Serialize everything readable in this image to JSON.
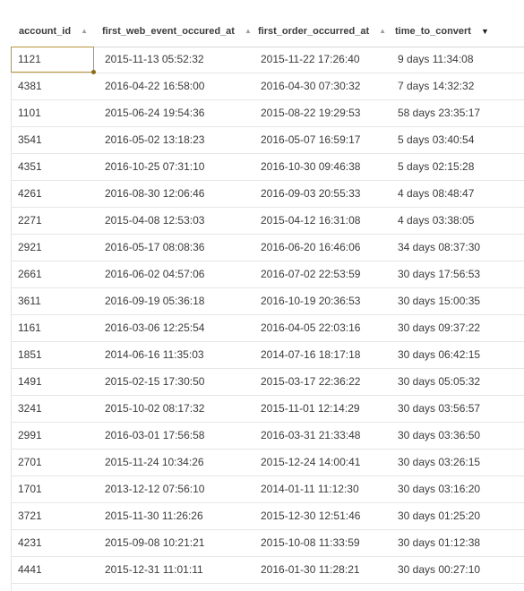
{
  "columns": [
    {
      "label": "account_id",
      "sort": "asc-inactive"
    },
    {
      "label": "first_web_event_occured_at",
      "sort": "asc-inactive"
    },
    {
      "label": "first_order_occurred_at",
      "sort": "asc-inactive"
    },
    {
      "label": "time_to_convert",
      "sort": "desc-active"
    }
  ],
  "sort_icons": {
    "inactive": "▲",
    "active": "▼"
  },
  "rows": [
    {
      "account_id": "1121",
      "first_web": "2015-11-13 05:52:32",
      "first_order": "2015-11-22 17:26:40",
      "time": "9 days 11:34:08"
    },
    {
      "account_id": "4381",
      "first_web": "2016-04-22 16:58:00",
      "first_order": "2016-04-30 07:30:32",
      "time": "7 days 14:32:32"
    },
    {
      "account_id": "1101",
      "first_web": "2015-06-24 19:54:36",
      "first_order": "2015-08-22 19:29:53",
      "time": "58 days 23:35:17"
    },
    {
      "account_id": "3541",
      "first_web": "2016-05-02 13:18:23",
      "first_order": "2016-05-07 16:59:17",
      "time": "5 days 03:40:54"
    },
    {
      "account_id": "4351",
      "first_web": "2016-10-25 07:31:10",
      "first_order": "2016-10-30 09:46:38",
      "time": "5 days 02:15:28"
    },
    {
      "account_id": "4261",
      "first_web": "2016-08-30 12:06:46",
      "first_order": "2016-09-03 20:55:33",
      "time": "4 days 08:48:47"
    },
    {
      "account_id": "2271",
      "first_web": "2015-04-08 12:53:03",
      "first_order": "2015-04-12 16:31:08",
      "time": "4 days 03:38:05"
    },
    {
      "account_id": "2921",
      "first_web": "2016-05-17 08:08:36",
      "first_order": "2016-06-20 16:46:06",
      "time": "34 days 08:37:30"
    },
    {
      "account_id": "2661",
      "first_web": "2016-06-02 04:57:06",
      "first_order": "2016-07-02 22:53:59",
      "time": "30 days 17:56:53"
    },
    {
      "account_id": "3611",
      "first_web": "2016-09-19 05:36:18",
      "first_order": "2016-10-19 20:36:53",
      "time": "30 days 15:00:35"
    },
    {
      "account_id": "1161",
      "first_web": "2016-03-06 12:25:54",
      "first_order": "2016-04-05 22:03:16",
      "time": "30 days 09:37:22"
    },
    {
      "account_id": "1851",
      "first_web": "2014-06-16 11:35:03",
      "first_order": "2014-07-16 18:17:18",
      "time": "30 days 06:42:15"
    },
    {
      "account_id": "1491",
      "first_web": "2015-02-15 17:30:50",
      "first_order": "2015-03-17 22:36:22",
      "time": "30 days 05:05:32"
    },
    {
      "account_id": "3241",
      "first_web": "2015-10-02 08:17:32",
      "first_order": "2015-11-01 12:14:29",
      "time": "30 days 03:56:57"
    },
    {
      "account_id": "2991",
      "first_web": "2016-03-01 17:56:58",
      "first_order": "2016-03-31 21:33:48",
      "time": "30 days 03:36:50"
    },
    {
      "account_id": "2701",
      "first_web": "2015-11-24 10:34:26",
      "first_order": "2015-12-24 14:00:41",
      "time": "30 days 03:26:15"
    },
    {
      "account_id": "1701",
      "first_web": "2013-12-12 07:56:10",
      "first_order": "2014-01-11 11:12:30",
      "time": "30 days 03:16:20"
    },
    {
      "account_id": "3721",
      "first_web": "2015-11-30 11:26:26",
      "first_order": "2015-12-30 12:51:46",
      "time": "30 days 01:25:20"
    },
    {
      "account_id": "4231",
      "first_web": "2015-09-08 10:21:21",
      "first_order": "2015-10-08 11:33:59",
      "time": "30 days 01:12:38"
    },
    {
      "account_id": "4441",
      "first_web": "2015-12-31 11:01:11",
      "first_order": "2016-01-30 11:28:21",
      "time": "30 days 00:27:10"
    }
  ],
  "selected_cell": {
    "row": 0,
    "column": "account_id"
  }
}
